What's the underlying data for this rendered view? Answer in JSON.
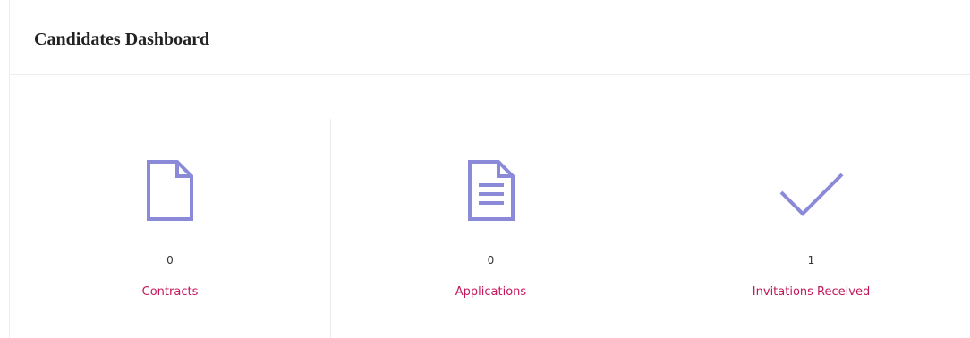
{
  "dashboard": {
    "title": "Candidates Dashboard"
  },
  "stats": [
    {
      "icon": "file-icon",
      "count": "0",
      "label": "Contracts"
    },
    {
      "icon": "document-lines-icon",
      "count": "0",
      "label": "Applications"
    },
    {
      "icon": "checkmark-icon",
      "count": "1",
      "label": "Invitations Received"
    }
  ],
  "colors": {
    "icon": "#8a8ad8",
    "label": "#c2185b",
    "divider": "#ececec"
  }
}
